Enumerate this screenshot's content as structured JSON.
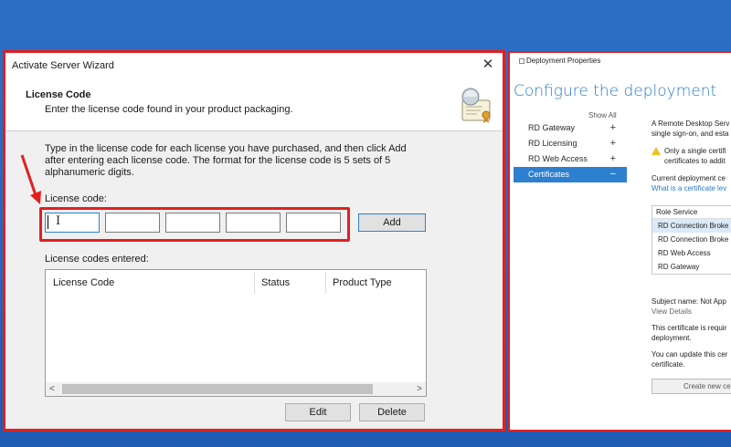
{
  "wizard": {
    "title": "Activate Server Wizard",
    "close_glyph": "✕",
    "header_title": "License Code",
    "header_subtitle": "Enter the license code found in your product packaging.",
    "header_icon": "certificate-icon",
    "instructions": "Type in the license code for each license you have purchased, and then click Add after entering each license code. The format for the license code is 5 sets of 5 alphanumeric digits.",
    "license_code_label": "License code:",
    "code_fields": [
      "",
      "",
      "",
      "",
      ""
    ],
    "add_label": "Add",
    "entered_label": "License codes entered:",
    "columns": [
      "License Code",
      "Status",
      "Product Type"
    ],
    "scroll_left": "<",
    "scroll_right": ">",
    "edit_label": "Edit",
    "delete_label": "Delete"
  },
  "deployment": {
    "window_title": "Deployment Properties",
    "heading": "Configure the deployment",
    "show_all": "Show All",
    "nav_items": [
      {
        "label": "RD Gateway",
        "glyph": "+"
      },
      {
        "label": "RD Licensing",
        "glyph": "+"
      },
      {
        "label": "RD Web Access",
        "glyph": "+"
      },
      {
        "label": "Certificates",
        "glyph": "−"
      }
    ],
    "intro_line1": "A Remote Desktop Serv",
    "intro_line2": "single sign-on, and esta",
    "warning_line1": "Only a single certifi",
    "warning_line2": "certificates to addit",
    "current_label": "Current deployment ce",
    "what_link": "What is a certificate lev",
    "role_header": "Role Service",
    "roles": [
      "RD Connection Broke",
      "RD Connection Broke",
      "RD Web Access",
      "RD Gateway"
    ],
    "subject_name": "Subject name: Not App",
    "view_details": "View Details",
    "req_line1": "This certificate is requir",
    "req_line2": "deployment.",
    "update_line1": "You can update this cer",
    "update_line2": "certificate.",
    "create_new": "Create new ce"
  },
  "colors": {
    "highlight": "#e02020",
    "accent": "#2d7fd0",
    "desktop": "#2566be"
  }
}
